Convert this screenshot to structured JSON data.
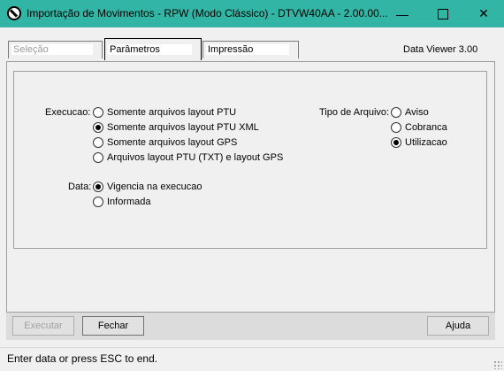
{
  "window": {
    "title": "Importação de Movimentos - RPW (Modo Clássico) - DTVW40AA - 2.00.00...",
    "controls": {
      "minimize": "—",
      "close": "✕"
    }
  },
  "tabs": [
    {
      "label": "Seleção",
      "state": "disabled"
    },
    {
      "label": "Parâmetros",
      "state": "active"
    },
    {
      "label": "Impressão",
      "state": "inactive"
    }
  ],
  "data_viewer": "Data Viewer 3.00",
  "params": {
    "execucao": {
      "label": "Execucao:",
      "options": [
        {
          "label": "Somente arquivos layout PTU",
          "checked": false
        },
        {
          "label": "Somente arquivos layout PTU XML",
          "checked": true
        },
        {
          "label": "Somente arquivos layout GPS",
          "checked": false
        },
        {
          "label": "Arquivos layout PTU (TXT) e layout GPS",
          "checked": false
        }
      ]
    },
    "tipo": {
      "label": "Tipo de Arquivo:",
      "options": [
        {
          "label": "Aviso",
          "checked": false
        },
        {
          "label": "Cobranca",
          "checked": false
        },
        {
          "label": "Utilizacao",
          "checked": true
        }
      ]
    },
    "data": {
      "label": "Data:",
      "options": [
        {
          "label": "Vigencia na execucao",
          "checked": true
        },
        {
          "label": "Informada",
          "checked": false
        }
      ]
    }
  },
  "buttons": {
    "executar": "Executar",
    "fechar": "Fechar",
    "ajuda": "Ajuda"
  },
  "status": "Enter data or press ESC to end.",
  "colors": {
    "titlebar": "#33b5a5",
    "background": "#f0f0f0"
  }
}
